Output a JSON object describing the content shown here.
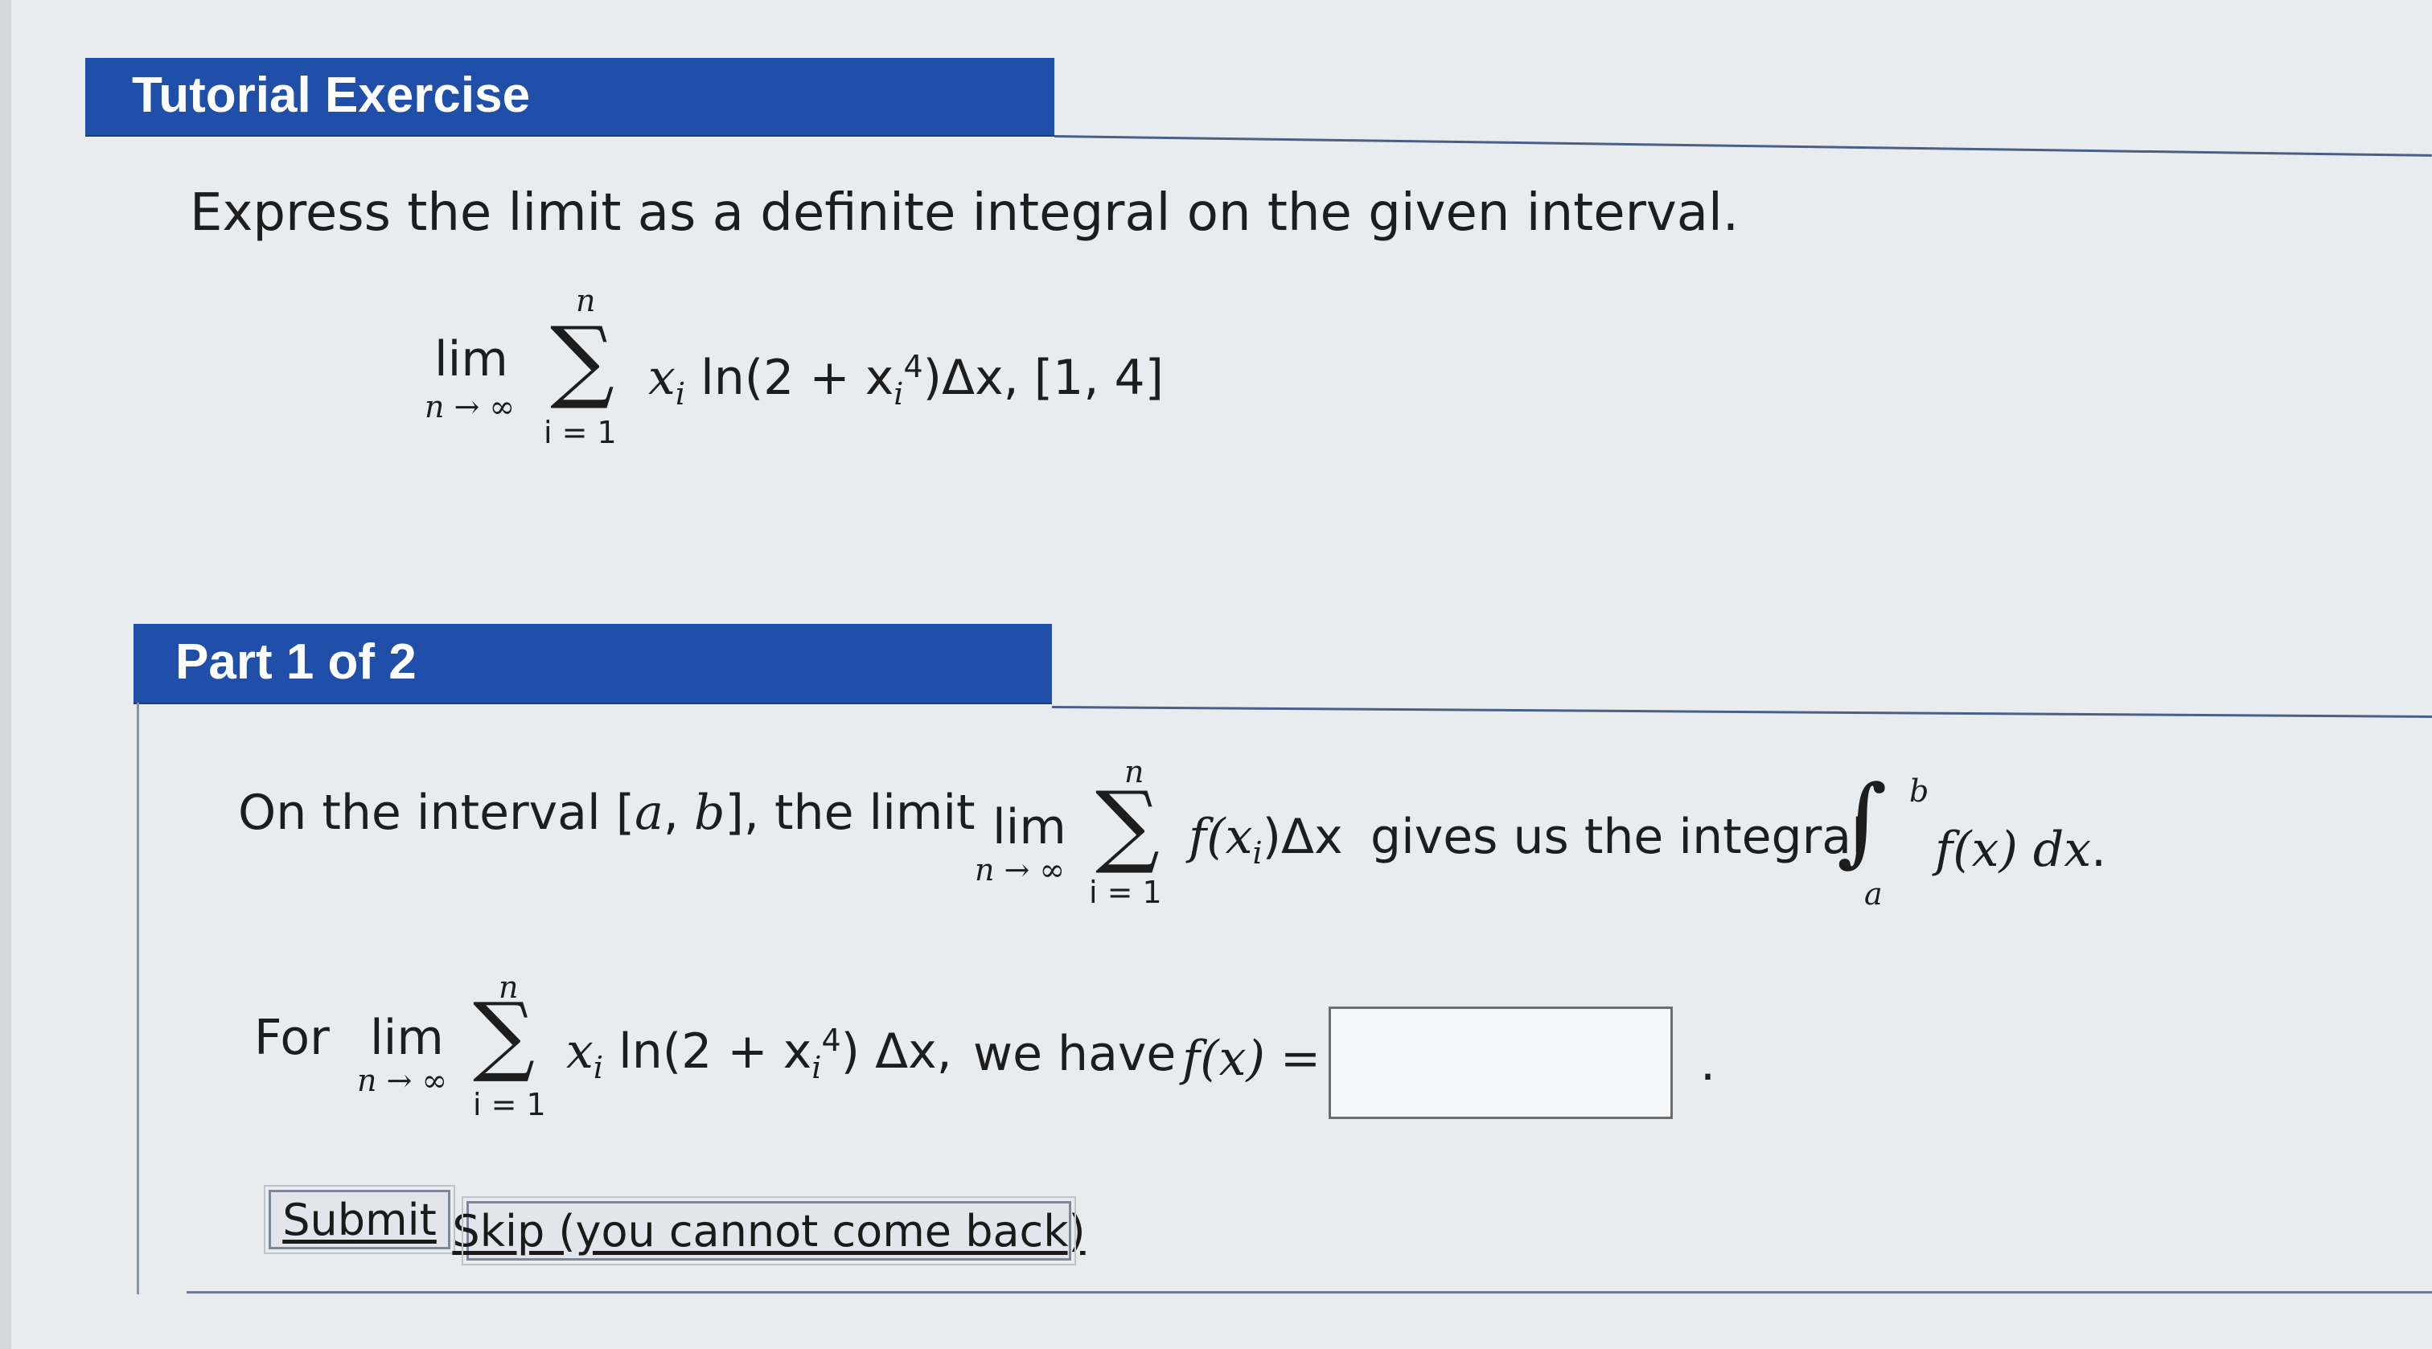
{
  "tutorial": {
    "header": "Tutorial Exercise",
    "instruction": "Express the limit as a definite integral on the given interval.",
    "expr": {
      "lim": "lim",
      "under_lim": "n → ∞",
      "sigma": "∑",
      "upper": "n",
      "lower": "i = 1",
      "term_xi": "x",
      "term_xi_sub": "i",
      "term_ln": "ln(2 + x",
      "term_sub": "i",
      "term_sup": "4",
      "term_end": ")Δx, [1, 4]"
    }
  },
  "part": {
    "header": "Part 1 of 2",
    "sentence": {
      "prefix": "On the interval [",
      "a": "a",
      "comma": ", ",
      "b": "b",
      "mid": "], the limit",
      "lim": "lim",
      "under_lim": "n → ∞",
      "sigma": "∑",
      "upper": "n",
      "lower": "i = 1",
      "fx": "f(x",
      "fx_sub": "i",
      "fx_end": ")Δx",
      "gives": "gives us the integral",
      "int": "∫",
      "int_upper": "b",
      "int_lower": "a",
      "integrand": "f(x) dx",
      "period": "."
    },
    "question": {
      "for": "For",
      "lim": "lim",
      "under_lim": "n → ∞",
      "sigma": "∑",
      "upper": "n",
      "lower": "i = 1",
      "xi": "x",
      "xi_sub": "i",
      "ln": "ln(2 + x",
      "sub": "i",
      "sup": "4",
      "end": ") Δx,",
      "we_have": "we have",
      "fx": "f(x) =",
      "answer_value": "",
      "period": "."
    },
    "buttons": {
      "submit": "Submit",
      "skip": "Skip (you cannot come back)"
    }
  }
}
